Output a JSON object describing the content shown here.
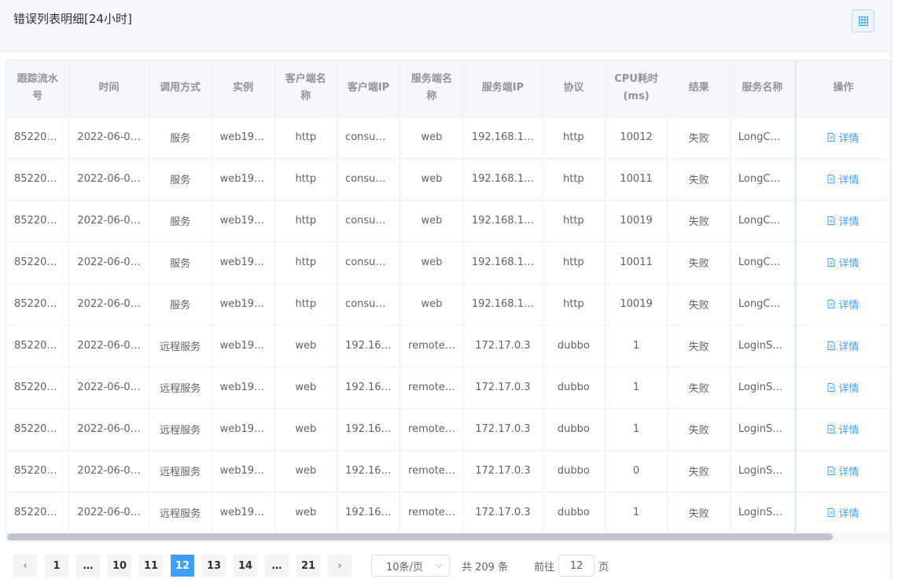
{
  "header": {
    "title": "错误列表明细[24小时]",
    "toggle_icon": "grid-icon"
  },
  "columns": [
    "跟踪流水号",
    "时间",
    "调用方式",
    "实例",
    "客户端名称",
    "客户端IP",
    "服务端名称",
    "服务端IP",
    "协议",
    "CPU耗时(ms)",
    "结果",
    "服务名称",
    "操作"
  ],
  "rows": [
    [
      "85220…",
      "2022-06-0…",
      "服务",
      "web19…",
      "http",
      "consu…",
      "web",
      "192.168.1…",
      "http",
      "10012",
      "失败",
      "LongC…",
      "详情"
    ],
    [
      "85220…",
      "2022-06-0…",
      "服务",
      "web19…",
      "http",
      "consu…",
      "web",
      "192.168.1…",
      "http",
      "10011",
      "失败",
      "LongC…",
      "详情"
    ],
    [
      "85220…",
      "2022-06-0…",
      "服务",
      "web19…",
      "http",
      "consu…",
      "web",
      "192.168.1…",
      "http",
      "10019",
      "失败",
      "LongC…",
      "详情"
    ],
    [
      "85220…",
      "2022-06-0…",
      "服务",
      "web19…",
      "http",
      "consu…",
      "web",
      "192.168.1…",
      "http",
      "10011",
      "失败",
      "LongC…",
      "详情"
    ],
    [
      "85220…",
      "2022-06-0…",
      "服务",
      "web19…",
      "http",
      "consu…",
      "web",
      "192.168.1…",
      "http",
      "10019",
      "失败",
      "LongC…",
      "详情"
    ],
    [
      "85220…",
      "2022-06-0…",
      "远程服务",
      "web19…",
      "web",
      "192.16…",
      "remote…",
      "172.17.0.3",
      "dubbo",
      "1",
      "失败",
      "LoginS…",
      "详情"
    ],
    [
      "85220…",
      "2022-06-0…",
      "远程服务",
      "web19…",
      "web",
      "192.16…",
      "remote…",
      "172.17.0.3",
      "dubbo",
      "1",
      "失败",
      "LoginS…",
      "详情"
    ],
    [
      "85220…",
      "2022-06-0…",
      "远程服务",
      "web19…",
      "web",
      "192.16…",
      "remote…",
      "172.17.0.3",
      "dubbo",
      "1",
      "失败",
      "LoginS…",
      "详情"
    ],
    [
      "85220…",
      "2022-06-0…",
      "远程服务",
      "web19…",
      "web",
      "192.16…",
      "remote…",
      "172.17.0.3",
      "dubbo",
      "0",
      "失败",
      "LoginS…",
      "详情"
    ],
    [
      "85220…",
      "2022-06-0…",
      "远程服务",
      "web19…",
      "web",
      "192.16…",
      "remote…",
      "172.17.0.3",
      "dubbo",
      "1",
      "失败",
      "LoginS…",
      "详情"
    ]
  ],
  "pagination": {
    "prev": "‹",
    "next": "›",
    "pages": [
      "1",
      "…",
      "10",
      "11",
      "12",
      "13",
      "14",
      "…",
      "21"
    ],
    "current": "12",
    "page_size": "10条/页",
    "total": "共 209 条",
    "goto_prefix": "前往",
    "goto_value": "12",
    "goto_suffix": "页"
  },
  "colors": {
    "accent": "#409eff",
    "header_bg": "#f5f7fa",
    "border": "#ebeef5"
  }
}
